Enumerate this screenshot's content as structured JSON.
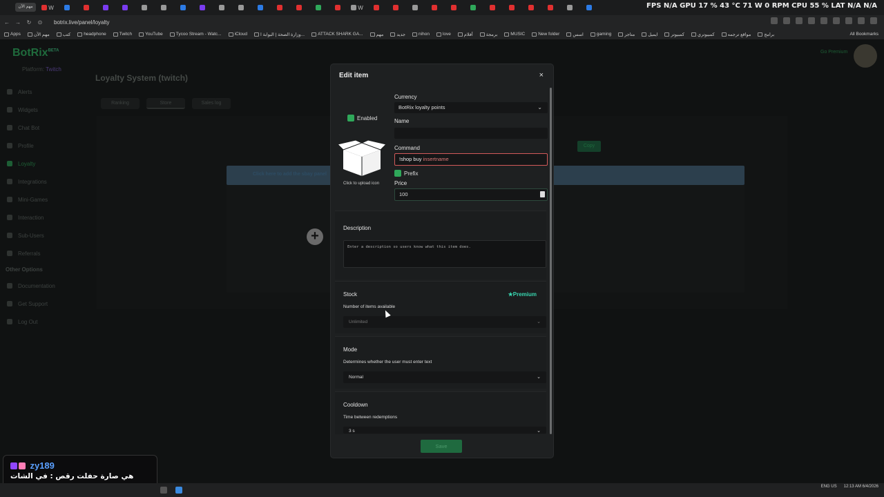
{
  "browser": {
    "first_tab": "مهم الآن",
    "tabs": [
      "W",
      "",
      "",
      "",
      "",
      "",
      "",
      "",
      "",
      "",
      "",
      "",
      "",
      "",
      "",
      "",
      "W",
      "",
      "",
      "",
      "",
      "",
      "",
      "",
      "",
      "",
      "",
      "",
      ""
    ],
    "stats": "FPS N/A   GPU 17 %  43 °C  71 W  0 RPM   CPU 55 %   LAT N/A  N/A",
    "url": "botrix.live/panel/loyalty",
    "bookmarks": [
      "Apps",
      "مهم الآن",
      "كتب",
      "headphone",
      "Twitch",
      "YouTube",
      "Tycoo Stream - Watc...",
      "iCloud",
      "وزارة الصحة | البوابة ا...",
      "ATTACK SHARK GA...",
      "مهم",
      "جديد",
      "nihon",
      "love",
      "أفلام",
      "برمجة",
      "MUSIC",
      "New folder",
      "اسس",
      "gaming",
      "متاجر",
      "ايميل",
      "كمبيوتر",
      "كمبيوتري",
      "مواقع ترجمه",
      "برامج"
    ],
    "all_bookmarks": "All Bookmarks"
  },
  "app": {
    "logo": "BotRix",
    "logo_sup": "BETA",
    "platform_label": "Platform:",
    "platform_value": "Twitch",
    "go_premium": "Go Premium",
    "sidebar": [
      {
        "label": "Alerts"
      },
      {
        "label": "Widgets"
      },
      {
        "label": "Chat Bot"
      },
      {
        "label": "Profile"
      },
      {
        "label": "Loyalty"
      },
      {
        "label": "Integrations"
      },
      {
        "label": "Mini-Games"
      },
      {
        "label": "Interaction"
      },
      {
        "label": "Sub-Users"
      },
      {
        "label": "Referrals"
      }
    ],
    "other_options_head": "Other Options",
    "other": [
      {
        "label": "Documentation"
      },
      {
        "label": "Get Support"
      },
      {
        "label": "Log Out"
      }
    ],
    "page_title": "Loyalty System (twitch)",
    "tabs": [
      "Ranking",
      "Store",
      "Sales log"
    ],
    "info_text": "Click here to add the sbay panel",
    "copy_label": "Copy"
  },
  "modal": {
    "title": "Edit item",
    "close": "×",
    "enabled_label": "Enabled",
    "upload_label": "Click to upload icon",
    "currency_label": "Currency",
    "currency_value": "BotRix loyalty points",
    "name_label": "Name",
    "name_value": "",
    "command_label": "Command",
    "command_prefix": "!shop buy ",
    "command_value": "insertname",
    "prefix_label": "Prefix",
    "price_label": "Price",
    "price_value": "100",
    "description_title": "Description",
    "description_placeholder": "Enter a description so users know what this item does.",
    "stock_title": "Stock",
    "premium_label": "Premium",
    "stock_sub": "Number of items available",
    "stock_value": "Unlimited",
    "mode_title": "Mode",
    "mode_sub": "Determines whether the user must enter text",
    "mode_value": "Normal",
    "cooldown_title": "Cooldown",
    "cooldown_sub": "Time between redemptions",
    "cooldown_value": "3 s",
    "save_label": "Save"
  },
  "chat": {
    "user": "zy189",
    "message": "هي صارة حفلت رقص : في الشات"
  },
  "taskbar": {
    "lang": "ENG US",
    "time": "12:13 AM",
    "date": "6/4/2026"
  },
  "colors": {
    "accent": "#2fa85a",
    "error": "#d35a5a",
    "premium": "#38d6b0"
  }
}
